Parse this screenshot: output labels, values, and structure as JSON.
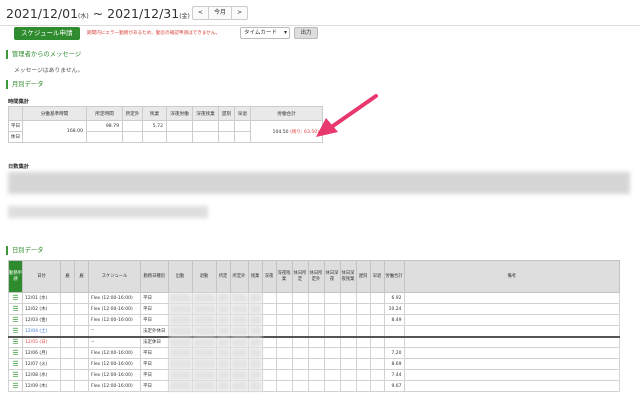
{
  "header": {
    "start": "2021/12/01",
    "start_dow": "(水)",
    "sep": " ~ ",
    "end": "2021/12/31",
    "end_dow": "(金)",
    "prev": "<",
    "this_month": "今月",
    "next": ">"
  },
  "toolbar": {
    "schedule_button": "スケジュール申請",
    "warning": "期間内にエラー勤務があるため、勤怠の確認申請はできません。",
    "select_value": "タイムカード",
    "output_button": "出力"
  },
  "message": {
    "title": "管理者からのメッセージ",
    "body": "メッセージはありません。"
  },
  "monthly": {
    "title": "月別データ",
    "summary_title": "時間集計",
    "headers": [
      "分働基準時間",
      "所定時間",
      "所定外",
      "残業",
      "深夜労働",
      "深夜残業",
      "遅刻",
      "早退",
      "労働合計"
    ],
    "row_labels": [
      "平日",
      "休日"
    ],
    "base_hours": "168.00",
    "scheduled": "98.79",
    "overtime": "5.72",
    "total": "104.50",
    "remaining": "(残り: 63.50)"
  },
  "days_summary_title": "日数集計",
  "daily": {
    "title": "日別データ",
    "headers": [
      "勤務申請",
      "日付",
      "雇",
      "雇",
      "スケジュール",
      "勤務日種別",
      "出勤",
      "退勤",
      "所定",
      "所定外",
      "残業",
      "深夜",
      "深夜残業",
      "休日所定",
      "休日所定外",
      "休日深夜",
      "休日深夜残業",
      "遅刻",
      "早退",
      "労働合計",
      "備考"
    ],
    "rows": [
      {
        "date": "12/01 (水)",
        "schedule": "Flex (12:00-16:00)",
        "type": "平日",
        "total": "6.92",
        "cls": ""
      },
      {
        "date": "12/02 (木)",
        "schedule": "Flex (12:00-16:00)",
        "type": "平日",
        "total": "10.24",
        "cls": ""
      },
      {
        "date": "12/03 (金)",
        "schedule": "Flex (12:00-16:00)",
        "type": "平日",
        "total": "8.49",
        "cls": ""
      },
      {
        "date": "12/04 (土)",
        "schedule": "--",
        "type": "法定外休日",
        "total": "",
        "cls": "sat"
      },
      {
        "date": "12/05 (日)",
        "schedule": "--",
        "type": "法定休日",
        "total": "",
        "cls": "sun sep"
      },
      {
        "date": "12/06 (月)",
        "schedule": "Flex (12:00-16:00)",
        "type": "平日",
        "total": "7.20",
        "cls": ""
      },
      {
        "date": "12/07 (火)",
        "schedule": "Flex (12:00-16:00)",
        "type": "平日",
        "total": "8.69",
        "cls": ""
      },
      {
        "date": "12/08 (水)",
        "schedule": "Flex (12:00-16:00)",
        "type": "平日",
        "total": "7.44",
        "cls": ""
      },
      {
        "date": "12/09 (木)",
        "schedule": "Flex (12:00-16:00)",
        "type": "平日",
        "total": "9.67",
        "cls": ""
      }
    ]
  },
  "colors": {
    "green": "#2e8b2e",
    "red": "#e23a3a",
    "arrow": "#e8386d"
  }
}
